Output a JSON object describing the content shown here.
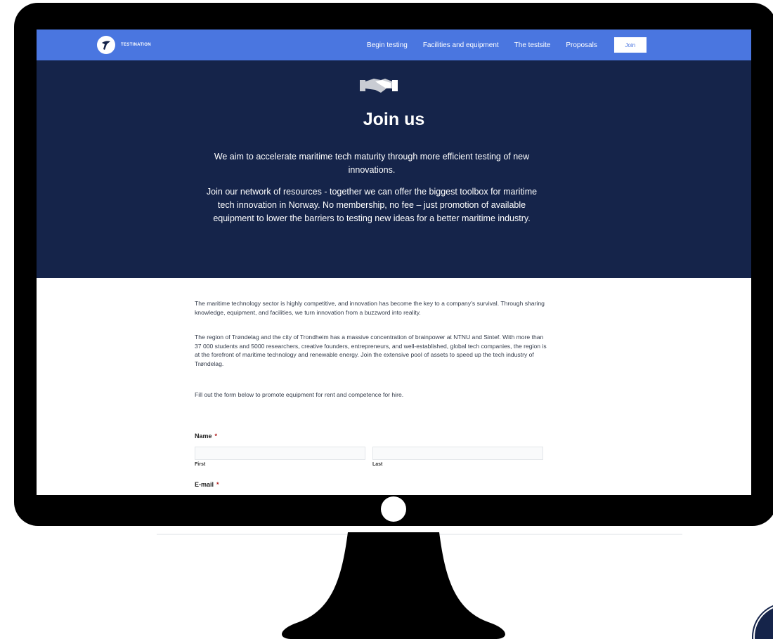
{
  "nav": {
    "logo_text": "TESTINATION",
    "links": [
      "Begin testing",
      "Facilities and equipment",
      "The testsite",
      "Proposals"
    ],
    "join_label": "Join"
  },
  "hero": {
    "icon": "handshake-icon",
    "title": "Join us",
    "paragraph1": "We aim to accelerate maritime tech maturity through more efficient testing of new innovations.",
    "paragraph2": "Join our network of resources -  together we can offer the biggest toolbox for maritime tech innovation in Norway. No membership, no fee – just promotion of available equipment to lower the barriers to testing new ideas for a better maritime industry."
  },
  "body": {
    "paragraph1": "The maritime technology sector is highly competitive, and innovation has become the key to a company’s survival. Through sharing knowledge, equipment, and facilities, we turn innovation from a buzzword into reality.",
    "paragraph2": "The region of Trøndelag and the city of Trondheim has a massive concentration of brainpower at NTNU and Sintef. With more than 37 000 students and 5000 researchers, creative founders, entrepreneurs, and well-established, global tech companies, the region is at the forefront of maritime technology and renewable energy. Join the extensive pool of assets to speed up the tech industry of Trøndelag.",
    "paragraph3": "Fill out the form below to promote equipment for rent and competence for hire."
  },
  "form": {
    "name_label": "Name",
    "required_mark": "*",
    "first_label": "First",
    "last_label": "Last",
    "email_label": "E-mail"
  },
  "colors": {
    "nav_bg": "#4a76e0",
    "hero_bg": "#15244a",
    "required": "#b01c1c"
  }
}
